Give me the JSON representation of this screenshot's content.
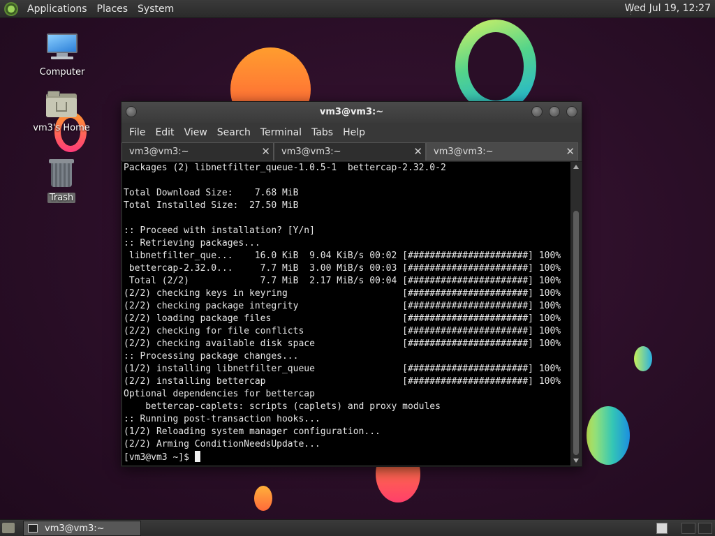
{
  "top_panel": {
    "menus": [
      "Applications",
      "Places",
      "System"
    ],
    "clock": "Wed Jul 19, 12:27"
  },
  "desktop_icons": [
    {
      "label": "Computer",
      "icon": "computer-icon"
    },
    {
      "label": "vm3's Home",
      "icon": "home-folder-icon"
    },
    {
      "label": "Trash",
      "icon": "trash-icon"
    }
  ],
  "window": {
    "title": "vm3@vm3:~",
    "menu": [
      "File",
      "Edit",
      "View",
      "Search",
      "Terminal",
      "Tabs",
      "Help"
    ],
    "tabs": [
      {
        "label": "vm3@vm3:~",
        "active": false
      },
      {
        "label": "vm3@vm3:~",
        "active": false
      },
      {
        "label": "vm3@vm3:~",
        "active": true
      }
    ],
    "terminal_lines": [
      "Packages (2) libnetfilter_queue-1.0.5-1  bettercap-2.32.0-2",
      "",
      "Total Download Size:    7.68 MiB",
      "Total Installed Size:  27.50 MiB",
      "",
      ":: Proceed with installation? [Y/n]",
      ":: Retrieving packages...",
      " libnetfilter_que...    16.0 KiB  9.04 KiB/s 00:02 [######################] 100%",
      " bettercap-2.32.0...     7.7 MiB  3.00 MiB/s 00:03 [######################] 100%",
      " Total (2/2)             7.7 MiB  2.17 MiB/s 00:04 [######################] 100%",
      "(2/2) checking keys in keyring                     [######################] 100%",
      "(2/2) checking package integrity                   [######################] 100%",
      "(2/2) loading package files                        [######################] 100%",
      "(2/2) checking for file conflicts                  [######################] 100%",
      "(2/2) checking available disk space                [######################] 100%",
      ":: Processing package changes...",
      "(1/2) installing libnetfilter_queue                [######################] 100%",
      "(2/2) installing bettercap                         [######################] 100%",
      "Optional dependencies for bettercap",
      "    bettercap-caplets: scripts (caplets) and proxy modules",
      ":: Running post-transaction hooks...",
      "(1/2) Reloading system manager configuration...",
      "(2/2) Arming ConditionNeedsUpdate..."
    ],
    "prompt": "[vm3@vm3 ~]$ "
  },
  "bottom_panel": {
    "task_label": "vm3@vm3:~"
  }
}
